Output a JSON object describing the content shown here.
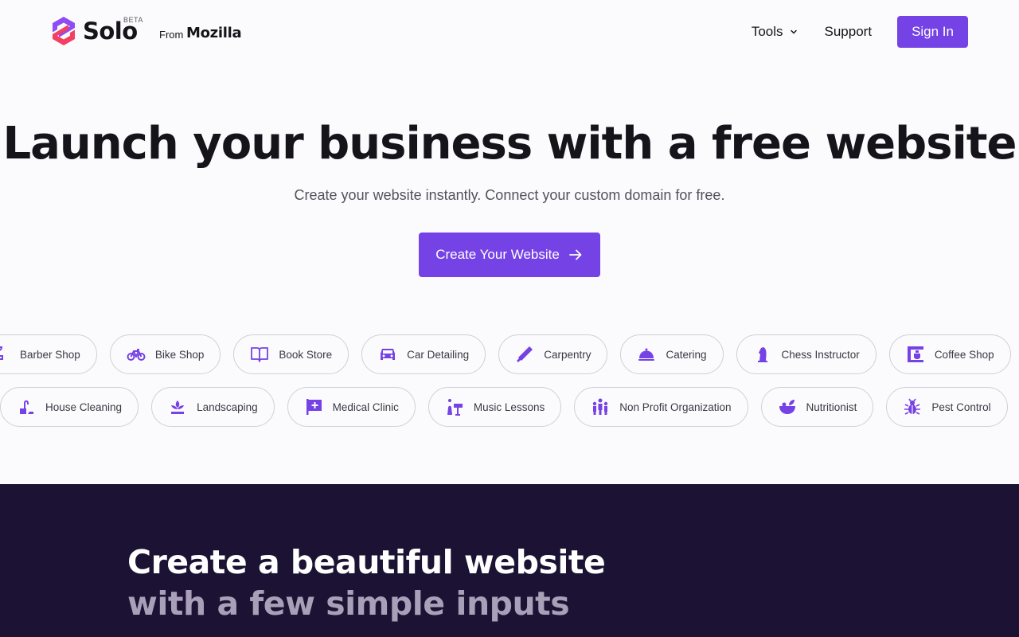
{
  "header": {
    "logo_text": "Solo",
    "beta_label": "BETA",
    "from_label": "From",
    "mozilla_label": "Mozilla",
    "nav": {
      "tools_label": "Tools",
      "support_label": "Support",
      "signin_label": "Sign In"
    }
  },
  "hero": {
    "title": "Launch your business with a free website",
    "subtitle": "Create your website instantly. Connect your custom domain for free.",
    "cta_label": "Create Your Website"
  },
  "categories_row1": [
    {
      "label": "Barber Shop",
      "icon": "barber-icon"
    },
    {
      "label": "Bike Shop",
      "icon": "bike-icon"
    },
    {
      "label": "Book Store",
      "icon": "book-icon"
    },
    {
      "label": "Car Detailing",
      "icon": "car-icon"
    },
    {
      "label": "Carpentry",
      "icon": "saw-icon"
    },
    {
      "label": "Catering",
      "icon": "cloche-icon"
    },
    {
      "label": "Chess Instructor",
      "icon": "chess-knight-icon"
    },
    {
      "label": "Coffee Shop",
      "icon": "coffee-machine-icon"
    }
  ],
  "categories_row2": [
    {
      "label": "House Cleaning",
      "icon": "vacuum-icon"
    },
    {
      "label": "Landscaping",
      "icon": "plant-icon"
    },
    {
      "label": "Medical Clinic",
      "icon": "medical-flag-icon"
    },
    {
      "label": "Music Lessons",
      "icon": "music-stand-icon"
    },
    {
      "label": "Non Profit Organization",
      "icon": "people-icon"
    },
    {
      "label": "Nutritionist",
      "icon": "salad-bowl-icon"
    },
    {
      "label": "Pest Control",
      "icon": "bug-icon"
    }
  ],
  "feature": {
    "heading_line1": "Create a beautiful website",
    "heading_line2": "with a few simple inputs"
  },
  "colors": {
    "accent": "#7542e5",
    "dark_bg": "#1c1233",
    "pill_border": "#cfcfd8",
    "muted_heading": "#a89fb8"
  }
}
